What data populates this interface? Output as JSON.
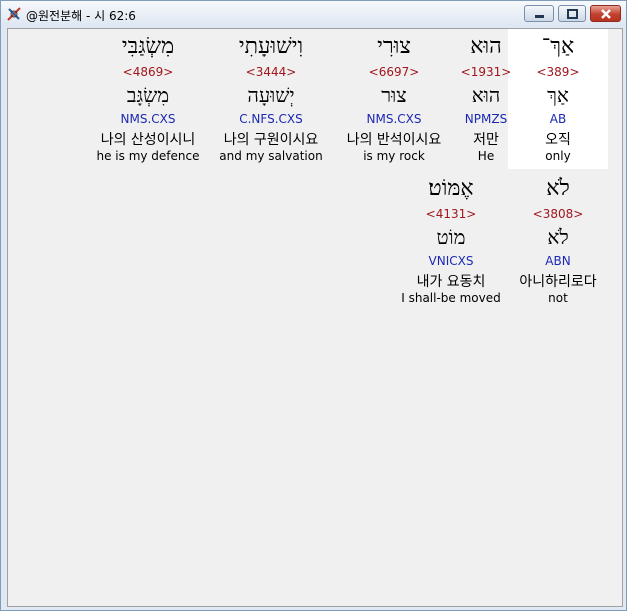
{
  "window": {
    "title": "@원전분해 - 시 62:6"
  },
  "row1": [
    {
      "hebrew": "אַךְ־",
      "strong": "<389>",
      "lemma": "אַךְ",
      "morph": "AB",
      "korean": "오직",
      "english": "only",
      "selected": true
    },
    {
      "hebrew": "הוּא",
      "strong": "<1931>",
      "lemma": "הוּא",
      "morph": "NPMZS",
      "korean": "저만",
      "english": "He",
      "selected": false
    },
    {
      "hebrew": "צוּרִי",
      "strong": "<6697>",
      "lemma": "צוּר",
      "morph": "NMS.CXS",
      "korean": "나의 반석이시요",
      "english": "is my rock",
      "selected": false
    },
    {
      "hebrew": "וִישׁוּעָתִי",
      "strong": "<3444>",
      "lemma": "יְשׁוּעָה",
      "morph": "C.NFS.CXS",
      "korean": "나의 구원이시요",
      "english": "and my salvation",
      "selected": false
    },
    {
      "hebrew": "מִשְׂגַּבִּי",
      "strong": "<4869>",
      "lemma": "מִשְׂגָּב",
      "morph": "NMS.CXS",
      "korean": "나의 산성이시니",
      "english": "he is my defence",
      "selected": false
    }
  ],
  "row2": [
    {
      "hebrew": "לֹא",
      "strong": "<3808>",
      "lemma": "לֹא",
      "morph": "ABN",
      "korean": "아니하리로다",
      "english": "not",
      "selected": false
    },
    {
      "hebrew": "אֶמּוֹט׃",
      "strong": "<4131>",
      "lemma": "מוֹט",
      "morph": "VNICXS",
      "korean": "내가 요동치",
      "english": "I shall-be moved",
      "selected": false
    }
  ]
}
